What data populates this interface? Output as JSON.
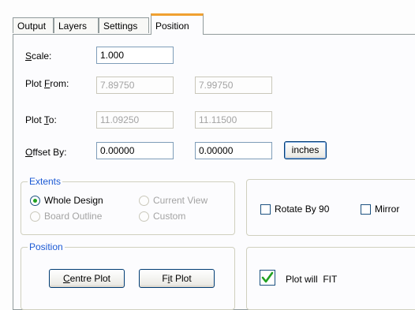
{
  "tabs": [
    "Output",
    "Layers",
    "Settings",
    "Position"
  ],
  "active_tab": "Position",
  "scale": {
    "label_ul": "S",
    "label_rest": "cale:",
    "value": "1.000"
  },
  "plot_from": {
    "label_pre": "Plot ",
    "label_ul": "F",
    "label_rest": "rom:",
    "x": "7.89750",
    "y": "7.99750"
  },
  "plot_to": {
    "label_pre": "Plot ",
    "label_ul": "T",
    "label_rest": "o:",
    "x": "11.09250",
    "y": "11.11500"
  },
  "offset_by": {
    "label_ul": "O",
    "label_rest": "ffset By:",
    "x": "0.00000",
    "y": "0.00000"
  },
  "units_button": "inches",
  "extents": {
    "title": "Extents",
    "options": [
      {
        "label": "Whole Design",
        "selected": true,
        "enabled": true
      },
      {
        "label": "Current View",
        "selected": false,
        "enabled": false
      },
      {
        "label": "Board Outline",
        "selected": false,
        "enabled": false
      },
      {
        "label": "Custom",
        "selected": false,
        "enabled": false
      }
    ]
  },
  "orientation": {
    "rotate_label": "Rotate By 90",
    "rotate_checked": false,
    "mirror_label": "Mirror",
    "mirror_checked": false
  },
  "position_group": {
    "title": "Position",
    "centre_ul": "C",
    "centre_rest": "entre Plot",
    "fit_pre": "F",
    "fit_ul": "i",
    "fit_rest": "t Plot"
  },
  "fit_status": {
    "text": "Plot will  FIT",
    "ok": true
  },
  "colors": {
    "accent_tab": "#f0a030",
    "group_title": "#1c5ad4",
    "check_green": "#21a121",
    "border": "#919b9c"
  }
}
